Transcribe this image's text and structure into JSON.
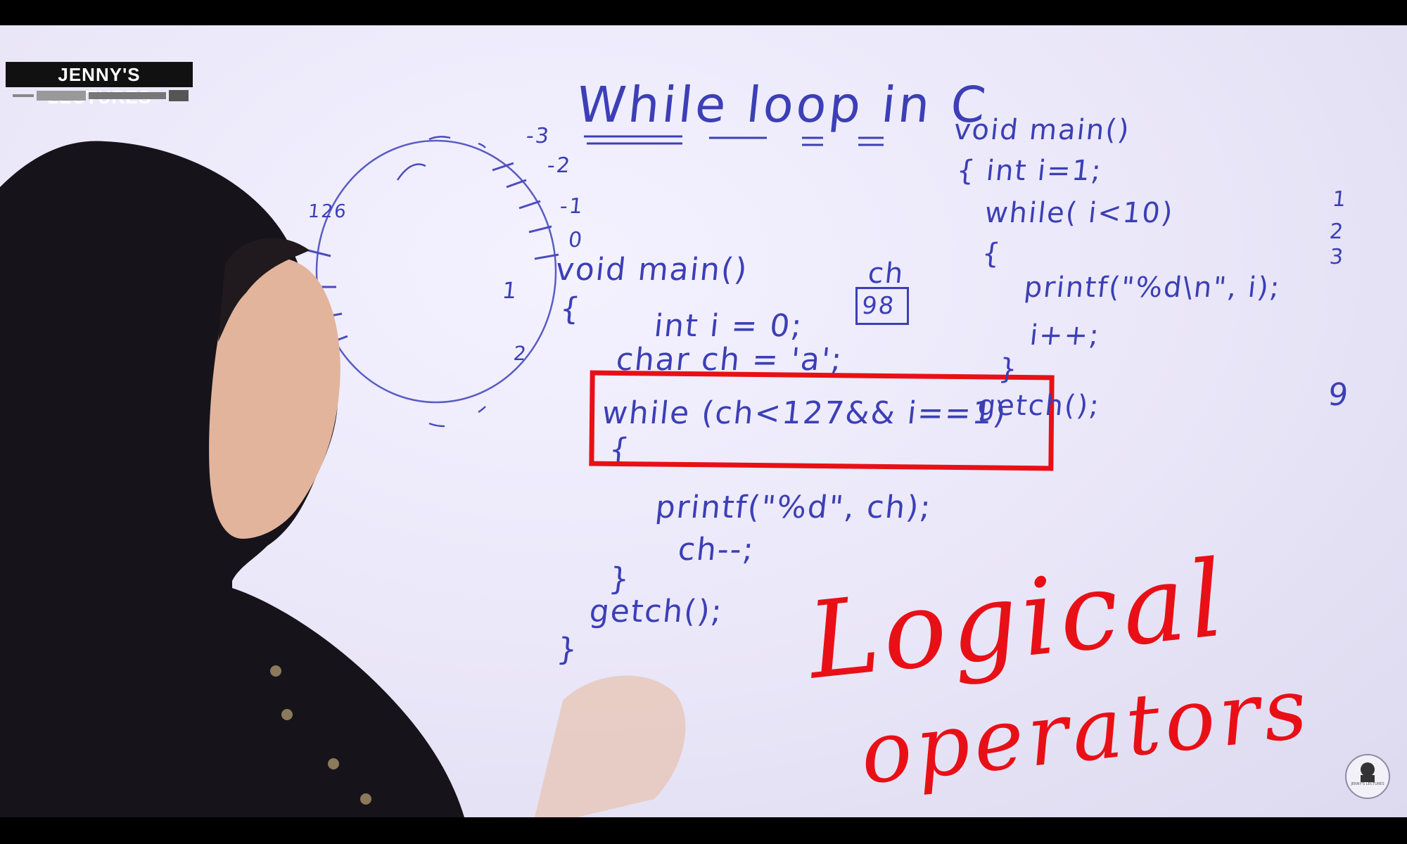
{
  "logo": {
    "text": "JENNY'S LECTURES"
  },
  "board": {
    "title": "While loop in C",
    "left_code": {
      "line1": "void main()",
      "line2": "{",
      "line3": "int i = 0;",
      "line4": "char ch = 'a';",
      "line5": "while (ch<127&& i==1)",
      "line6": "{",
      "line7": "printf(\"%d\", ch);",
      "line8": "ch--;",
      "line9": "}",
      "line10": "getch();",
      "line11": "}"
    },
    "variable_box": {
      "label": "ch",
      "value": "98"
    },
    "right_code": {
      "line1": "void main()",
      "line2": "{ int i=1;",
      "line3": "while( i<10)",
      "line4": "{",
      "line5": "printf(\"%d\\n\", i);",
      "line6": "i++;",
      "line7": "}",
      "line8": "getch();"
    },
    "output_column": {
      "v1": "1",
      "v2": "2",
      "v3": "3",
      "v9": "9"
    },
    "circle_labels": {
      "a": "-3",
      "b": "-2",
      "c": "-1",
      "d": "0",
      "e": "1",
      "f": "2",
      "g": "126"
    },
    "annotation": {
      "line1": "Logical",
      "line2": "operators"
    }
  },
  "badge": {
    "text": "JENNY'S LECTURES"
  },
  "colors": {
    "marker_blue": "#3c3fb5",
    "marker_red": "#e81016",
    "highlight_box": "#e81016",
    "board": "#ece9f8"
  }
}
